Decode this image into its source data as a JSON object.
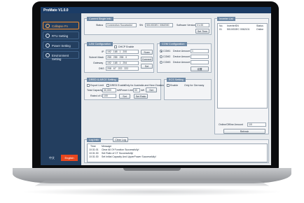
{
  "app": {
    "title": "ProMate V1.0.0"
  },
  "sidebar": {
    "items": [
      {
        "label": "Collapse Fn"
      },
      {
        "label": "RTU Setting"
      },
      {
        "label": "Power Setting"
      },
      {
        "label": "Environment Setting"
      }
    ],
    "lang": {
      "chinese": "中文",
      "english": "English"
    }
  },
  "single_info": {
    "title": "Current Single Info",
    "status_label": "Status",
    "status_value": "Connection Successful",
    "sn_label": "SN",
    "sn_value": "5010GDEC 0062000",
    "sw_label": "Software Version",
    "sw_value": "V1.00",
    "set_time": "Set Time"
  },
  "lan": {
    "title": "LAN Configuration",
    "dhcp": "DHCP Enable",
    "ip_label": "IP",
    "ip": [
      "192",
      "168",
      "1",
      "200"
    ],
    "mask_label": "Subnet Mask",
    "mask": [
      "255",
      "255",
      "255",
      "0"
    ],
    "gateway_label": "Gateway",
    "gateway": [
      "192",
      "168",
      "1",
      "254"
    ],
    "dns_label": "DNS",
    "dns": [
      "208",
      "67",
      "222",
      "222"
    ],
    "scan": "Scan",
    "connect": "Connect",
    "set": "Set"
  },
  "com": {
    "title": "COM Configuration",
    "ports": [
      {
        "name": "COM1",
        "label": "Device Amount",
        "value": "1"
      },
      {
        "name": "COM2",
        "label": "Device Amount",
        "value": ""
      },
      {
        "name": "COM3",
        "label": "Device Amount",
        "value": ""
      }
    ],
    "set": "设置"
  },
  "drm": {
    "title": "DRED & ARCE Setting",
    "export_limit": "Export Limit",
    "dred_enable": "DRED Enable",
    "dred_note": "Only for Australia and New Zealand",
    "total_capacity_label": "Total Capacity",
    "total_capacity": "30,000",
    "kw1": "kW",
    "power_limit_label": "Power Limit",
    "power_limit": "00",
    "kw2": "kW",
    "set": "Set",
    "rated_label": "Rated of CT",
    "rated": "100",
    "set2": "Set",
    "set_ratio": "Set Ratio"
  },
  "ecs": {
    "title": "ECS Setting",
    "enable": "Enable",
    "note": "Only for Germany"
  },
  "inverter_list": {
    "title": "Inverter List",
    "headers": [
      "No.",
      "InverterSN",
      "Status"
    ],
    "rows": [
      [
        "01",
        "5010GDEC 0062101",
        "Online"
      ]
    ],
    "amount_label": "Online/Offline Amount",
    "amount": "1/0",
    "refresh": "Refresh"
  },
  "log": {
    "title": "Log Info",
    "clear": "Clear Log",
    "headers": [
      "Time",
      "Message"
    ],
    "rows": [
      [
        "10:31:01",
        "Clear All Of Function Successfully!"
      ],
      [
        "10:31:30",
        "Set Ratio of CT Successfully!"
      ],
      [
        "10:31:30",
        "Set Initial Capacity And UpperPower Successfully!"
      ]
    ]
  }
}
